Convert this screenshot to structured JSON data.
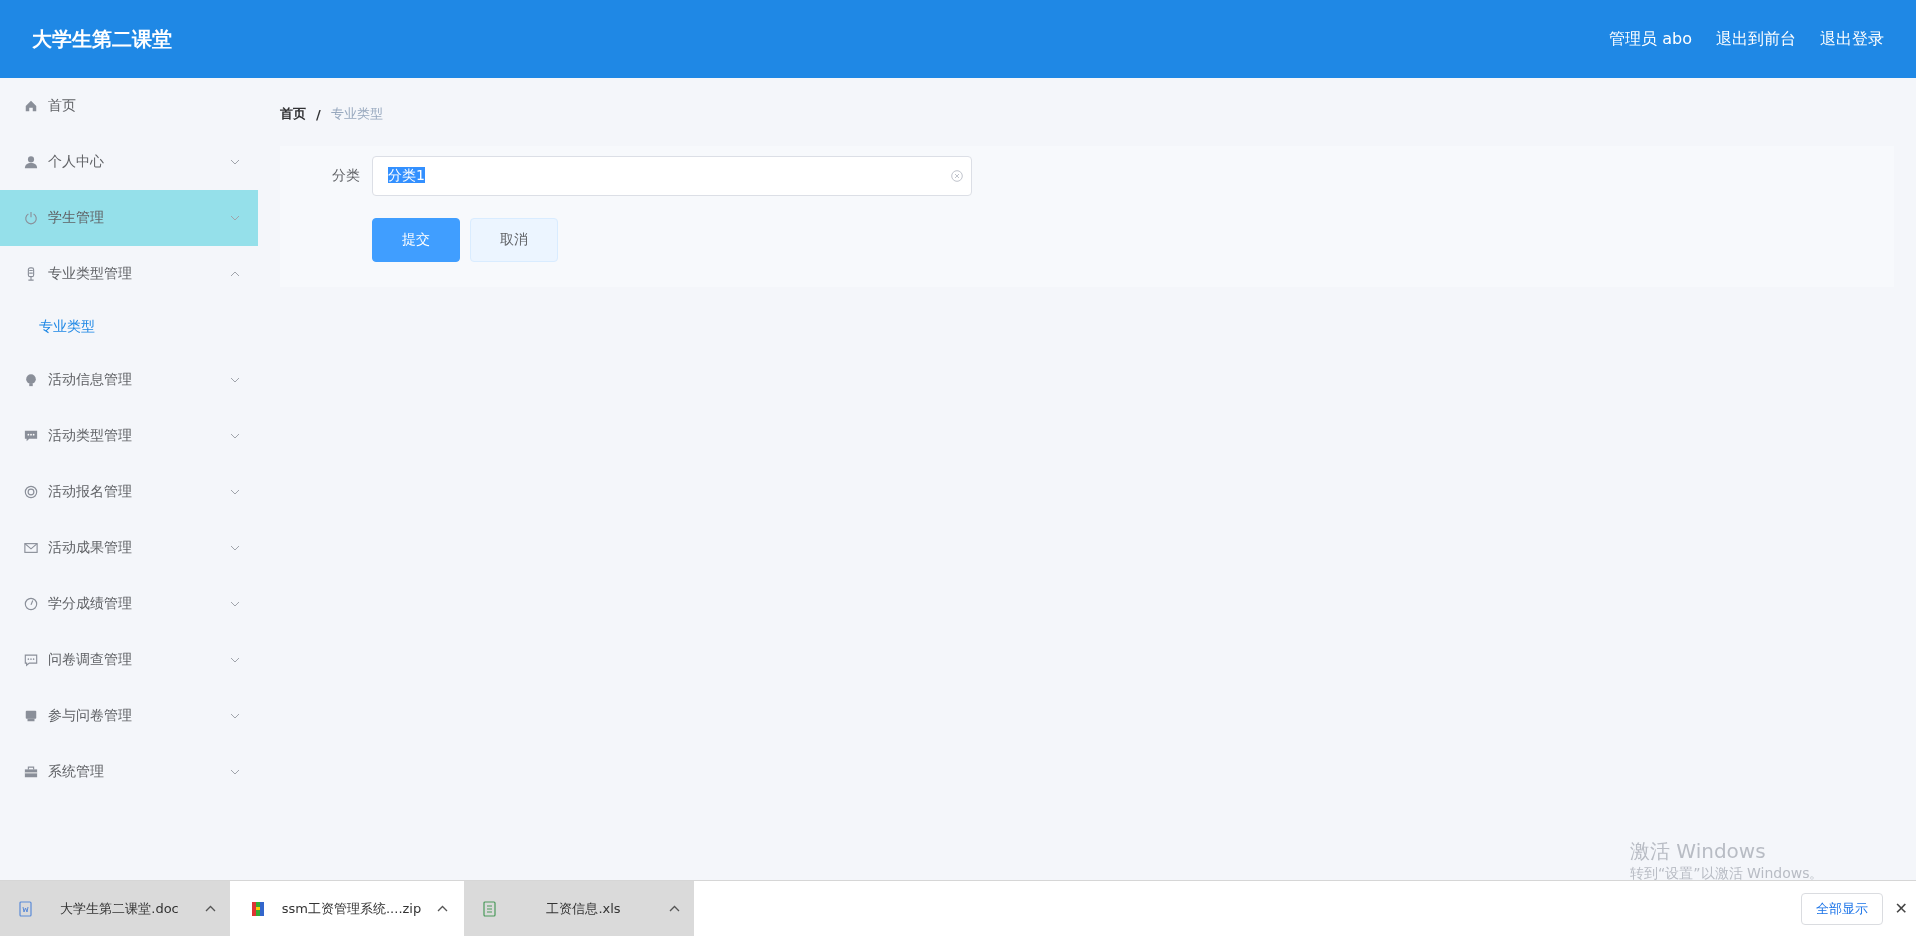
{
  "header": {
    "title": "大学生第二课堂",
    "links": [
      "管理员 abo",
      "退出到前台",
      "退出登录"
    ]
  },
  "sidebar": {
    "items": [
      {
        "label": "首页",
        "highlighted": false
      },
      {
        "label": "个人中心",
        "highlighted": false,
        "expanded": false
      },
      {
        "label": "学生管理",
        "highlighted": true,
        "expanded": false
      },
      {
        "label": "专业类型管理",
        "highlighted": false,
        "expanded": true,
        "children": [
          {
            "label": "专业类型",
            "selected": true
          }
        ]
      },
      {
        "label": "活动信息管理",
        "highlighted": false,
        "expanded": false
      },
      {
        "label": "活动类型管理",
        "highlighted": false,
        "expanded": false
      },
      {
        "label": "活动报名管理",
        "highlighted": false,
        "expanded": false
      },
      {
        "label": "活动成果管理",
        "highlighted": false,
        "expanded": false
      },
      {
        "label": "学分成绩管理",
        "highlighted": false,
        "expanded": false
      },
      {
        "label": "问卷调查管理",
        "highlighted": false,
        "expanded": false
      },
      {
        "label": "参与问卷管理",
        "highlighted": false,
        "expanded": false
      },
      {
        "label": "系统管理",
        "highlighted": false,
        "expanded": false
      }
    ]
  },
  "breadcrumb": {
    "items": [
      "首页",
      "专业类型"
    ],
    "separator": "/"
  },
  "form": {
    "label": "分类",
    "value": "分类1",
    "text_selected": true,
    "buttons": [
      "提交",
      "取消"
    ]
  },
  "watermark": {
    "title": "激活 Windows",
    "subtitle": "转到“设置”以激活 Windows。"
  },
  "downloads": {
    "items": [
      {
        "name": "大学生第二课堂.doc",
        "kind": "doc",
        "shaded": true
      },
      {
        "name": "ssm工资管理系统....zip",
        "kind": "zip",
        "shaded": false
      },
      {
        "name": "工资信息.xls",
        "kind": "xls",
        "shaded": true
      }
    ],
    "show_all": "全部显示",
    "close": "✕"
  }
}
